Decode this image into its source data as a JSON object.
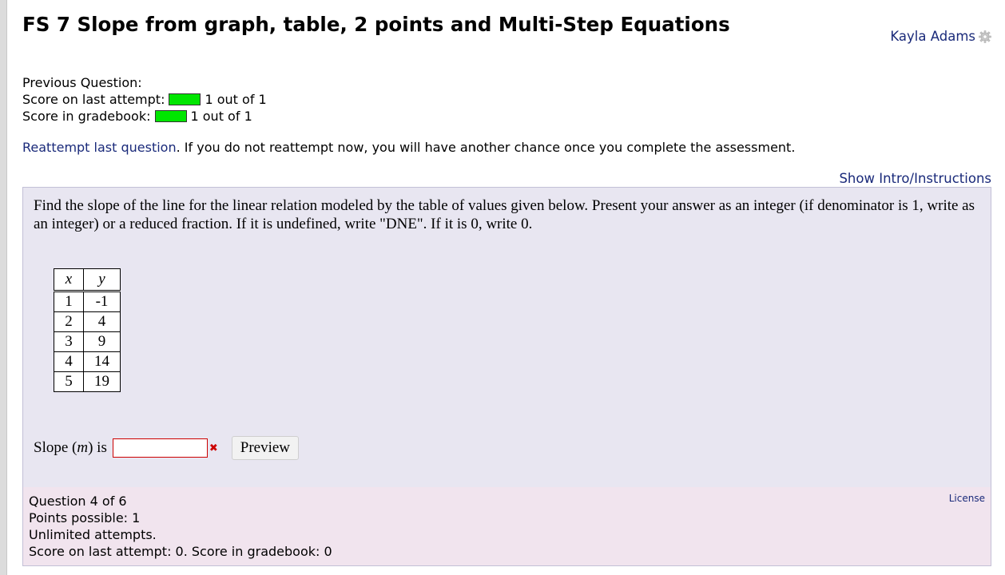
{
  "header": {
    "title": "FS 7 Slope from graph, table, 2 points and Multi-Step Equations",
    "user_name": "Kayla Adams",
    "user_icon": "gear-icon"
  },
  "previous": {
    "heading": "Previous Question:",
    "last_attempt_label": "Score on last attempt:",
    "last_attempt_value": "1 out of 1",
    "gradebook_label": "Score in gradebook:",
    "gradebook_value": "1 out of 1",
    "bar_color": "#00e600",
    "bar_fill": 1
  },
  "reattempt": {
    "link": "Reattempt last question",
    "text": ". If you do not reattempt now, you will have another chance once you complete the assessment."
  },
  "show_intro": "Show Intro/Instructions",
  "question": {
    "prompt": "Find the slope of the line for the linear relation modeled by the table of values given below. Present your answer as an integer (if denominator is 1, write as an integer) or a reduced fraction. If it is undefined, write \"DNE\". If it is 0, write 0.",
    "table": {
      "headers": [
        "x",
        "y"
      ],
      "rows": [
        [
          "1",
          "-1"
        ],
        [
          "2",
          "4"
        ],
        [
          "3",
          "9"
        ],
        [
          "4",
          "14"
        ],
        [
          "5",
          "19"
        ]
      ]
    },
    "answer_label_pre": "Slope (",
    "answer_label_var": "m",
    "answer_label_post": ") is",
    "answer_value": "",
    "preview_label": "Preview"
  },
  "info": {
    "question_number": "Question 4 of 6",
    "points": "Points possible: 1",
    "attempts": "Unlimited attempts.",
    "score": "Score on last attempt: 0. Score in gradebook: 0",
    "license": "License"
  },
  "colors": {
    "link": "#1a2a7a",
    "question_bg": "#e8e6f1",
    "info_bg": "#f1e4ee",
    "error": "#cc0000"
  }
}
